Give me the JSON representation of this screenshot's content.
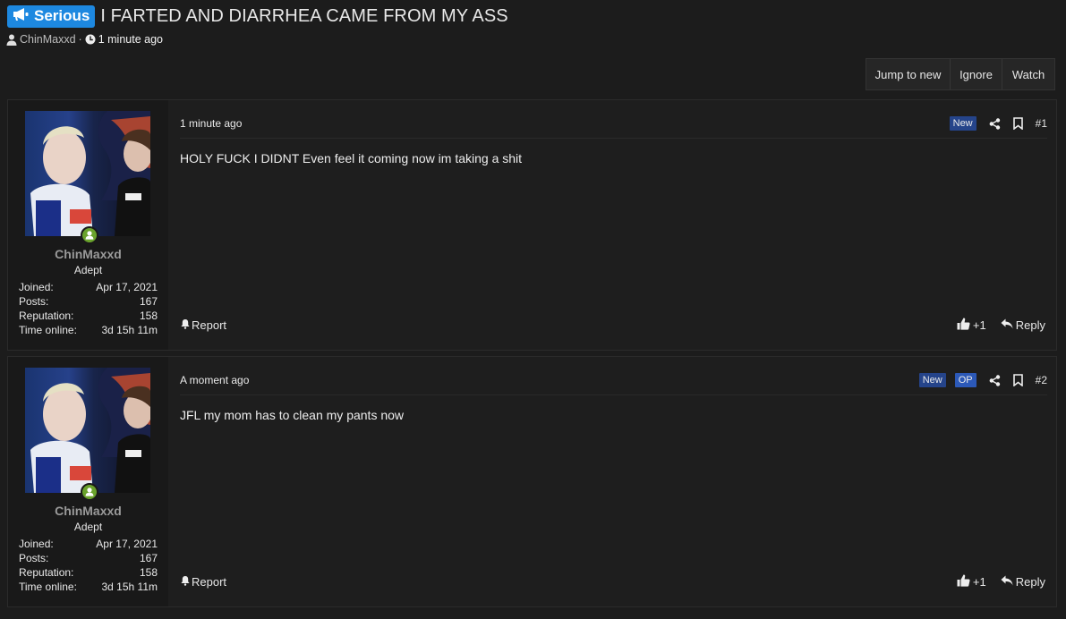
{
  "thread": {
    "prefix": "Serious",
    "title": "I FARTED AND DIARRHEA CAME FROM MY ASS",
    "author": "ChinMaxxd",
    "separator": "·",
    "time": "1 minute ago"
  },
  "actions": {
    "jump": "Jump to new",
    "ignore": "Ignore",
    "watch": "Watch"
  },
  "posts": [
    {
      "date": "1 minute ago",
      "badges": [
        "New"
      ],
      "number": "#1",
      "body": "HOLY FUCK I DIDNT Even feel it coming now im taking a shit",
      "report": "Report",
      "likes": "+1",
      "reply": "Reply",
      "user": {
        "name": "ChinMaxxd",
        "title": "Adept",
        "stats": [
          {
            "label": "Joined:",
            "value": "Apr 17, 2021"
          },
          {
            "label": "Posts:",
            "value": "167"
          },
          {
            "label": "Reputation:",
            "value": "158"
          },
          {
            "label": "Time online:",
            "value": "3d 15h 11m"
          }
        ]
      }
    },
    {
      "date": "A moment ago",
      "badges": [
        "New",
        "OP"
      ],
      "number": "#2",
      "body": "JFL my mom has to clean my pants now",
      "report": "Report",
      "likes": "+1",
      "reply": "Reply",
      "user": {
        "name": "ChinMaxxd",
        "title": "Adept",
        "stats": [
          {
            "label": "Joined:",
            "value": "Apr 17, 2021"
          },
          {
            "label": "Posts:",
            "value": "167"
          },
          {
            "label": "Reputation:",
            "value": "158"
          },
          {
            "label": "Time online:",
            "value": "3d 15h 11m"
          }
        ]
      }
    }
  ],
  "colors": {
    "prefix_bg": "#1d88e0",
    "badge_bg": "#25448a",
    "online": "#6aa32c",
    "page_bg": "#1c1c1c"
  },
  "icons": [
    "megaphone-icon",
    "user-icon",
    "clock-icon",
    "share-icon",
    "bookmark-icon",
    "bell-icon",
    "thumbs-up-icon",
    "reply-icon"
  ]
}
